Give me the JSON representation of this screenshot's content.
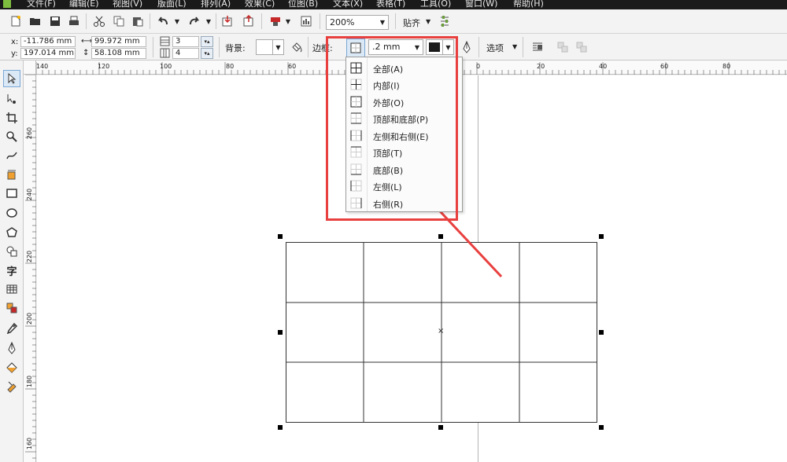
{
  "menubar": {
    "items": [
      "文件(F)",
      "编辑(E)",
      "视图(V)",
      "版面(L)",
      "排列(A)",
      "效果(C)",
      "位图(B)",
      "文本(X)",
      "表格(T)",
      "工具(O)",
      "窗口(W)",
      "帮助(H)"
    ]
  },
  "toolbar": {
    "zoom": "200%",
    "snap_label": "贴齐"
  },
  "property_bar": {
    "x_label": "x:",
    "x_value": "-11.786 mm",
    "y_label": "y:",
    "y_value": "197.014 mm",
    "width_value": "99.972 mm",
    "height_value": "58.108 mm",
    "rows_value": "3",
    "cols_value": "4",
    "background_label": "背景:",
    "border_label": "边框:",
    "border_width": ".2 mm",
    "border_color": "#1a1a1a",
    "options_label": "选项"
  },
  "rulers": {
    "top_labels": [
      "140",
      "120",
      "100",
      "80",
      "60",
      "0",
      "20",
      "40",
      "60",
      "80"
    ],
    "left_labels": [
      "260",
      "240",
      "220",
      "200",
      "180",
      "160"
    ]
  },
  "border_menu": {
    "items": [
      {
        "label": "全部(A)",
        "icon": "border-all-icon"
      },
      {
        "label": "内部(I)",
        "icon": "border-inside-icon"
      },
      {
        "label": "外部(O)",
        "icon": "border-outside-icon"
      },
      {
        "label": "顶部和底部(P)",
        "icon": "border-top-bottom-icon"
      },
      {
        "label": "左侧和右侧(E)",
        "icon": "border-left-right-icon"
      },
      {
        "label": "顶部(T)",
        "icon": "border-top-icon"
      },
      {
        "label": "底部(B)",
        "icon": "border-bottom-icon"
      },
      {
        "label": "左侧(L)",
        "icon": "border-left-icon"
      },
      {
        "label": "右侧(R)",
        "icon": "border-right-icon"
      }
    ]
  },
  "table": {
    "rows": 3,
    "cols": 4
  },
  "colors": {
    "annotation": "#e8403f",
    "menubar_bg": "#1a1a1a"
  }
}
